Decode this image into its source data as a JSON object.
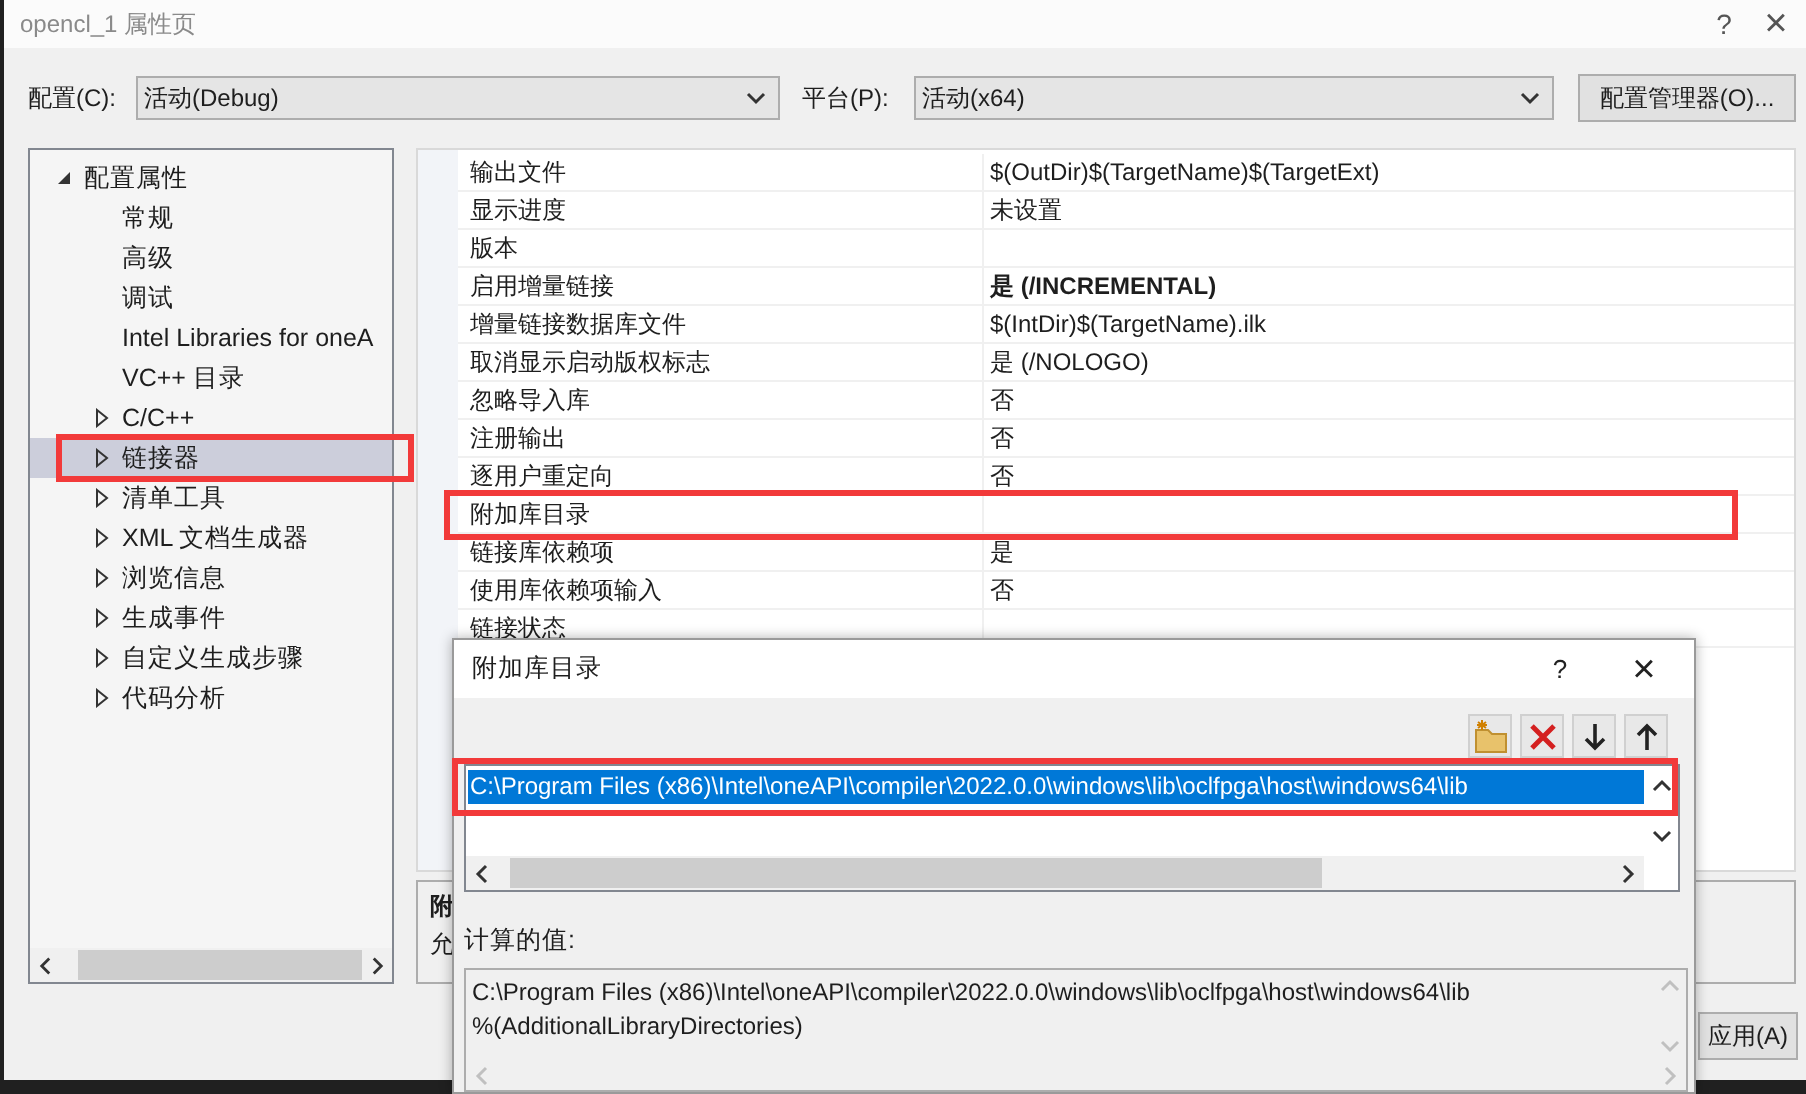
{
  "window": {
    "title": "opencl_1 属性页",
    "help": "?",
    "close": "×"
  },
  "config_bar": {
    "configuration_label": "配置(C):",
    "configuration": "活动(Debug)",
    "platform_label": "平台(P):",
    "platform": "活动(x64)",
    "manager_button": "配置管理器(O)..."
  },
  "tree": {
    "items": [
      {
        "label": "配置属性",
        "kind": "folder",
        "expanded": true,
        "selected": false,
        "highlighted": false,
        "children": [
          {
            "label": "常规",
            "kind": "leaf",
            "selected": false,
            "highlighted": false
          },
          {
            "label": "高级",
            "kind": "leaf",
            "selected": false,
            "highlighted": false
          },
          {
            "label": "调试",
            "kind": "leaf",
            "selected": false,
            "highlighted": false
          },
          {
            "label": "Intel Libraries for oneA",
            "kind": "leaf",
            "selected": false,
            "highlighted": false
          },
          {
            "label": "VC++ 目录",
            "kind": "leaf",
            "selected": false,
            "highlighted": false
          },
          {
            "label": "C/C++",
            "kind": "folder",
            "expanded": false,
            "selected": false,
            "highlighted": false
          },
          {
            "label": "链接器",
            "kind": "folder",
            "expanded": false,
            "selected": true,
            "highlighted": true
          },
          {
            "label": "清单工具",
            "kind": "folder",
            "expanded": false,
            "selected": false,
            "highlighted": false
          },
          {
            "label": "XML 文档生成器",
            "kind": "folder",
            "expanded": false,
            "selected": false,
            "highlighted": false
          },
          {
            "label": "浏览信息",
            "kind": "folder",
            "expanded": false,
            "selected": false,
            "highlighted": false
          },
          {
            "label": "生成事件",
            "kind": "folder",
            "expanded": false,
            "selected": false,
            "highlighted": false
          },
          {
            "label": "自定义生成步骤",
            "kind": "folder",
            "expanded": false,
            "selected": false,
            "highlighted": false
          },
          {
            "label": "代码分析",
            "kind": "folder",
            "expanded": false,
            "selected": false,
            "highlighted": false
          }
        ]
      }
    ]
  },
  "properties": [
    {
      "name": "输出文件",
      "value": "$(OutDir)$(TargetName)$(TargetExt)",
      "bold": false,
      "highlighted": false
    },
    {
      "name": "显示进度",
      "value": "未设置",
      "bold": false,
      "highlighted": false
    },
    {
      "name": "版本",
      "bold": false,
      "highlighted": false
    },
    {
      "name": "启用增量链接",
      "value": "是 (/INCREMENTAL)",
      "bold": true,
      "highlighted": false
    },
    {
      "name": "增量链接数据库文件",
      "value": "$(IntDir)$(TargetName).ilk",
      "bold": false,
      "highlighted": false
    },
    {
      "name": "取消显示启动版权标志",
      "value": "是 (/NOLOGO)",
      "bold": false,
      "highlighted": false
    },
    {
      "name": "忽略导入库",
      "value": "否",
      "bold": false,
      "highlighted": false
    },
    {
      "name": "注册输出",
      "value": "否",
      "bold": false,
      "highlighted": false
    },
    {
      "name": "逐用户重定向",
      "value": "否",
      "bold": false,
      "highlighted": false
    },
    {
      "name": "附加库目录",
      "bold": false,
      "highlighted": true
    },
    {
      "name": "链接库依赖项",
      "value": "是",
      "bold": false,
      "highlighted": false
    },
    {
      "name": "使用库依赖项输入",
      "value": "否",
      "bold": false,
      "highlighted": false
    },
    {
      "name": "链接状态",
      "bold": false,
      "highlighted": false
    }
  ],
  "description": {
    "title": "附",
    "text": "允"
  },
  "apply_button": "应用(A)",
  "dialog": {
    "title": "附加库目录",
    "help": "?",
    "close": "×",
    "entries": [
      {
        "text": "C:\\Program Files (x86)\\Intel\\oneAPI\\compiler\\2022.0.0\\windows\\lib\\oclfpga\\host\\windows64\\lib",
        "selected": true,
        "highlighted": true
      }
    ],
    "computed_label": "计算的值:",
    "computed_lines": [
      "C:\\Program Files (x86)\\Intel\\oneAPI\\compiler\\2022.0.0\\windows\\lib\\oclfpga\\host\\windows64\\lib",
      "%(AdditionalLibraryDirectories)"
    ]
  }
}
